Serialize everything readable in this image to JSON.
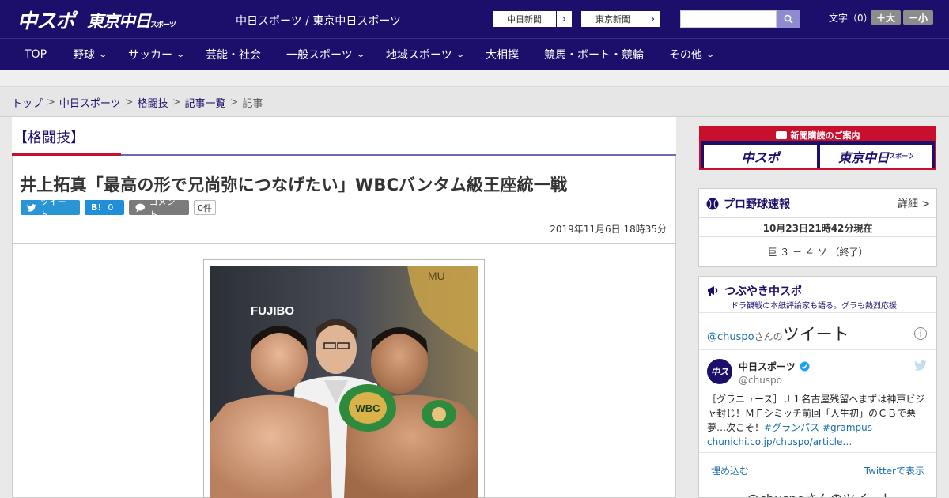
{
  "header": {
    "logo_chuspo": "中スポ",
    "logo_tokyo": "東京中日",
    "logo_tokyo_small": "スポーツ",
    "site_name": "中日スポーツ / 東京中日スポーツ",
    "link_chunichi": "中日新聞",
    "link_tokyo": "東京新聞",
    "font_label": "文字（0）",
    "font_plus": "＋大",
    "font_minus": "－小",
    "search_value": ""
  },
  "nav": {
    "items": [
      "TOP",
      "野球",
      "サッカー",
      "芸能・社会",
      "一般スポーツ",
      "地域スポーツ",
      "大相撲",
      "競馬・ボート・競輪",
      "その他"
    ]
  },
  "breadcrumb": [
    "トップ",
    "中日スポーツ",
    "格闘技",
    "記事一覧",
    "記事"
  ],
  "article": {
    "category": "【格闘技】",
    "title": "井上拓真「最高の形で兄尚弥につなげたい」WBCバンタム級王座統一戦",
    "tweet_label": "ツイート",
    "hatena_label": "B!",
    "hatena_count": "0",
    "comment_label": "コメント",
    "comment_count": "0件",
    "date": "2019年11月6日 18時35分",
    "photo_text_left": "FUJIBO",
    "photo_text_top": "MU",
    "photo_belt": "WBC"
  },
  "sidebar": {
    "ad_header": "新聞購読のご案内",
    "ad_chuspo": "中スポ",
    "ad_tokyo": "東京中日",
    "ad_tokyo_small": "スポーツ",
    "baseball": {
      "title": "プロ野球速報",
      "detail": "詳細 >",
      "as_of": "10月23日21時42分現在",
      "score": "巨 ３ － ４ ソ （終了）"
    },
    "tweets": {
      "title": "つぶやき中スポ",
      "subtitle": "ドラ観戦の本紙評論家も語る。グラも熱烈応援",
      "handle_prefix": "@chuspo",
      "handle_san": "さんの",
      "tweet_word": "ツイート",
      "account_name": "中日スポーツ",
      "account_handle": "@chuspo",
      "tweet_body": "［グラニュース］Ｊ１名古屋残留へまずは神戸ビジャ封じ！ＭＦシミッチ前回「人生初」のＣＢで悪夢…次こそ！",
      "hashtag1": "#グランパス",
      "hashtag2": "#grampus",
      "link": "chunichi.co.jp/chuspo/article…",
      "embed": "埋め込む",
      "view_on_twitter": "Twitterで表示",
      "footer": "@chuspoさんのツイート"
    }
  },
  "colors": {
    "brand": "#1b0f6b",
    "accent_red": "#c8102e",
    "twitter": "#2a95d4"
  }
}
